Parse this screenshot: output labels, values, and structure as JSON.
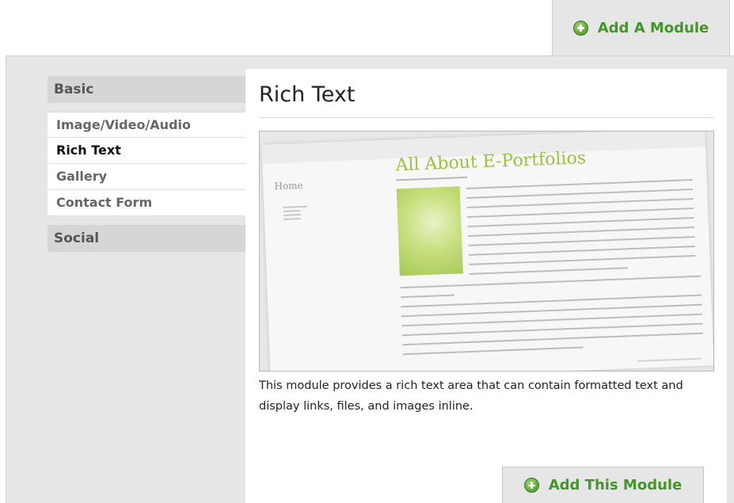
{
  "header": {
    "add_module_tab": "Add A Module"
  },
  "sidebar": {
    "categories": [
      {
        "label": "Basic",
        "items": [
          {
            "label": "Image/Video/Audio",
            "active": false
          },
          {
            "label": "Rich Text",
            "active": true
          },
          {
            "label": "Gallery",
            "active": false
          },
          {
            "label": "Contact Form",
            "active": false
          }
        ]
      },
      {
        "label": "Social",
        "items": []
      }
    ]
  },
  "main": {
    "title": "Rich Text",
    "preview": {
      "page_title": "All About E-Portfolios",
      "home_label": "Home"
    },
    "description": "This module provides a rich text area that can contain formatted text and display links, files, and images inline.",
    "add_button": "Add This Module"
  },
  "colors": {
    "accent_green": "#44952a",
    "panel_gray": "#e6e6e6",
    "header_gray": "#d6d6d6"
  },
  "icons": {
    "add_module_tab": "plus-circle-icon",
    "add_button": "plus-circle-icon"
  }
}
